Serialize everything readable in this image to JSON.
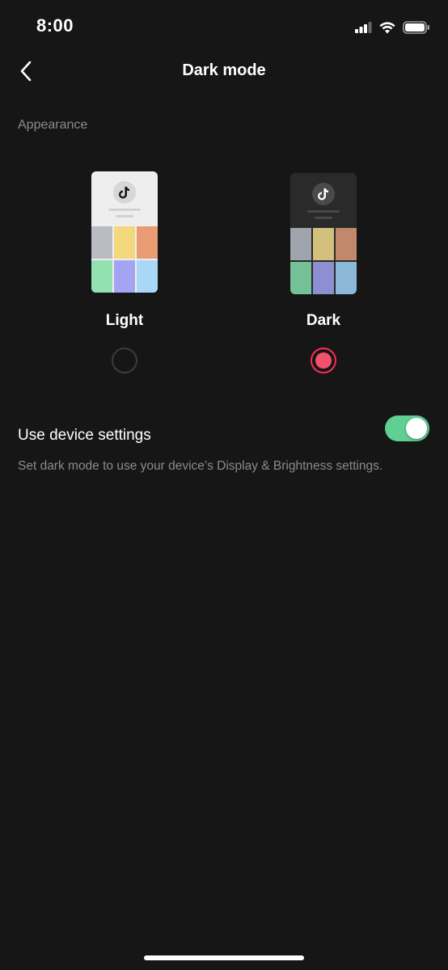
{
  "status_bar": {
    "time": "8:00",
    "icons": [
      "signal-icon",
      "wifi-icon",
      "battery-icon"
    ]
  },
  "header": {
    "title": "Dark mode",
    "back_icon": "chevron-left-icon"
  },
  "appearance": {
    "section_label": "Appearance",
    "options": [
      {
        "label": "Light",
        "selected": false,
        "preview_tiles": [
          "#b9bcc3",
          "#f3d97b",
          "#e99b72",
          "#93e0b1",
          "#a3a5f4",
          "#a9d8f7"
        ]
      },
      {
        "label": "Dark",
        "selected": true,
        "preview_tiles": [
          "#a0a4ac",
          "#d3c07c",
          "#c2886c",
          "#76c098",
          "#8d8fd3",
          "#8cb8d8"
        ]
      }
    ]
  },
  "device_settings": {
    "label": "Use device settings",
    "enabled": true,
    "description": "Set dark mode to use your device’s Display & Brightness settings."
  },
  "colors": {
    "background": "#161616",
    "accent": "#fe2c55",
    "toggle_on": "#5fcf92",
    "secondary_text": "#8b8b8b"
  }
}
